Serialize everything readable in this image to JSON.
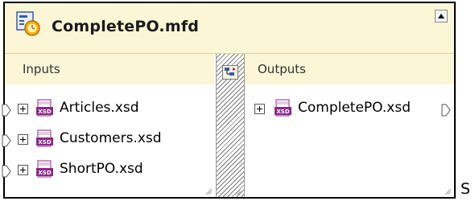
{
  "component": {
    "title": "CompletePO.mfd",
    "icon": "mapping-file-icon",
    "collapse_icon": "collapse-up-icon"
  },
  "inputs": {
    "header": "Inputs",
    "items": [
      {
        "label": "Articles.xsd",
        "icon": "xsd-schema-icon"
      },
      {
        "label": "Customers.xsd",
        "icon": "xsd-schema-icon"
      },
      {
        "label": "ShortPO.xsd",
        "icon": "xsd-schema-icon"
      }
    ]
  },
  "outputs": {
    "header": "Outputs",
    "items": [
      {
        "label": "CompletePO.xsd",
        "icon": "xsd-schema-icon"
      }
    ]
  },
  "trailing_text": "S",
  "colors": {
    "header_bg": "#fbf7d6",
    "border": "#000000",
    "xsd_icon": "#8a2a8a",
    "connector": "#ffffff"
  }
}
